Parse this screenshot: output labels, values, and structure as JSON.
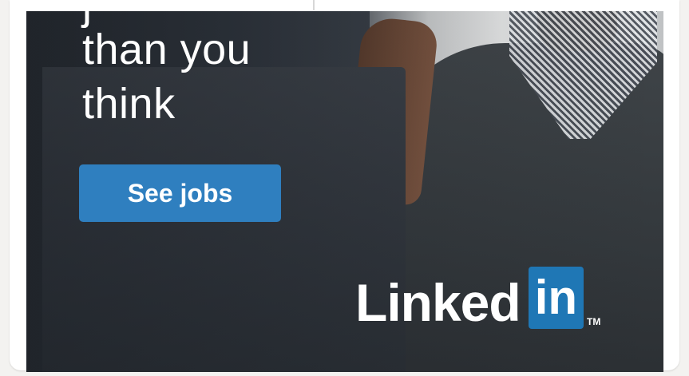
{
  "ad": {
    "headline_partial": "j",
    "headline_line1": "than you",
    "headline_line2": "think",
    "cta_label": "See jobs",
    "logo_text": "Linked",
    "logo_box_text": "in",
    "logo_trademark": "TM"
  },
  "colors": {
    "cta_background": "#2f7fbf",
    "logo_box_background": "#1f77b5",
    "headline_text": "#ffffff"
  }
}
